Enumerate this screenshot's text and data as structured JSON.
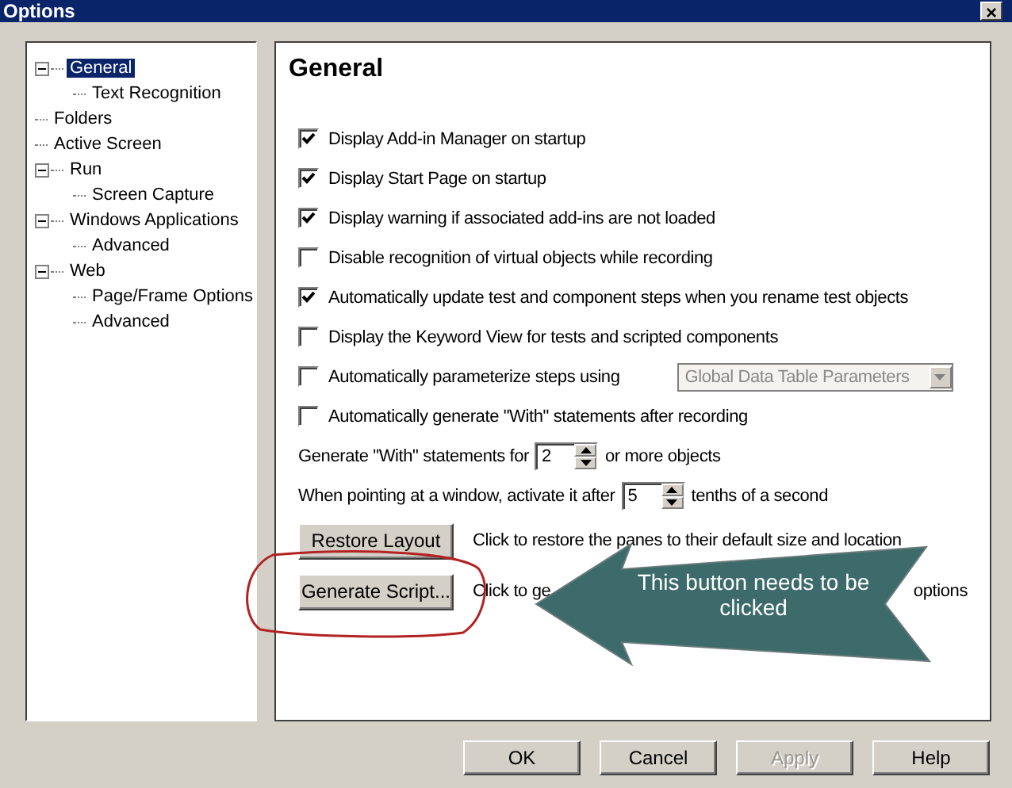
{
  "window": {
    "title": "Options",
    "close": "×"
  },
  "tree": [
    {
      "label": "General",
      "selected": true,
      "expanded": true,
      "children": [
        {
          "label": "Text Recognition",
          "selected": false
        }
      ]
    },
    {
      "label": "Folders",
      "selected": false
    },
    {
      "label": "Active Screen",
      "selected": false
    },
    {
      "label": "Run",
      "selected": false,
      "expanded": true,
      "children": [
        {
          "label": "Screen Capture",
          "selected": false
        }
      ]
    },
    {
      "label": "Windows Applications",
      "selected": false,
      "expanded": true,
      "children": [
        {
          "label": "Advanced",
          "selected": false
        }
      ]
    },
    {
      "label": "Web",
      "selected": false,
      "expanded": true,
      "children": [
        {
          "label": "Page/Frame Options",
          "selected": false
        },
        {
          "label": "Advanced",
          "selected": false
        }
      ]
    }
  ],
  "panel": {
    "heading": "General",
    "items": [
      {
        "kind": "checkbox",
        "label": "Display Add-in Manager on startup",
        "checked": true
      },
      {
        "kind": "checkbox",
        "label": "Display Start Page on startup",
        "checked": true
      },
      {
        "kind": "checkbox",
        "label": "Display warning if associated add-ins are not loaded",
        "checked": true
      },
      {
        "kind": "checkbox",
        "label": "Disable recognition of virtual objects while recording",
        "checked": false
      },
      {
        "kind": "checkbox",
        "label": "Automatically update test and component steps when you rename test objects",
        "checked": true
      },
      {
        "kind": "checkbox",
        "label": "Display the Keyword View for tests and scripted components",
        "checked": false
      },
      {
        "kind": "checkbox-dropdown",
        "label": "Automatically parameterize steps using",
        "checked": false,
        "dropdown": {
          "value": "Global Data Table Parameters",
          "disabled": true
        }
      },
      {
        "kind": "checkbox",
        "label": "Automatically generate \"With\" statements after recording",
        "checked": false
      },
      {
        "kind": "spin",
        "before": "Generate \"With\" statements for",
        "value": "2",
        "after": "or more objects"
      },
      {
        "kind": "spin",
        "before": "When pointing at a window, activate it after",
        "value": "5",
        "after": "tenths of a second"
      },
      {
        "kind": "button",
        "label": "Restore Layout",
        "hint": "Click to restore the panes to their default size and location"
      },
      {
        "kind": "button",
        "label": "Generate Script...",
        "hint": "Click to ge",
        "hint_end": "options"
      }
    ]
  },
  "buttons": [
    {
      "label": "OK",
      "disabled": false
    },
    {
      "label": "Cancel",
      "disabled": false
    },
    {
      "label": "Apply",
      "disabled": true
    },
    {
      "label": "Help",
      "disabled": false
    }
  ],
  "callout": {
    "text": "This button needs to be clicked"
  }
}
